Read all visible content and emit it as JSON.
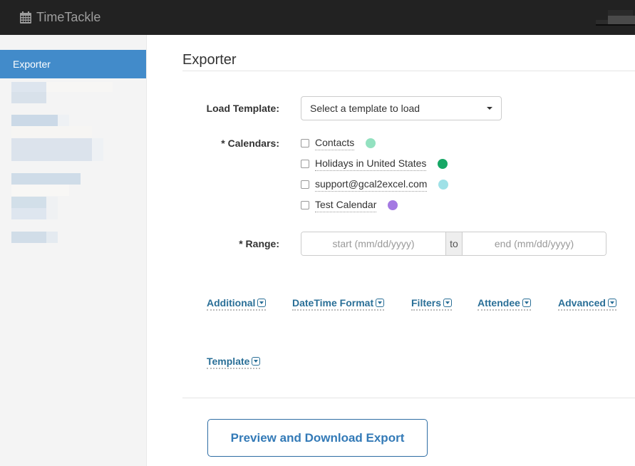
{
  "app": {
    "name": "TimeTackle",
    "logo_icon": "calendar-icon"
  },
  "sidebar": {
    "active_item": "Exporter",
    "redacted_items_count": 6
  },
  "page": {
    "title": "Exporter"
  },
  "form": {
    "load_template": {
      "label": "Load Template:",
      "placeholder": "Select a template to load"
    },
    "calendars": {
      "label": "* Calendars:",
      "items": [
        {
          "name": "Contacts",
          "checked": false,
          "color": "#93e1c0"
        },
        {
          "name": "Holidays in United States",
          "checked": false,
          "color": "#16a765"
        },
        {
          "name": "support@gcal2excel.com",
          "checked": false,
          "color": "#9fe1e7"
        },
        {
          "name": "Test Calendar",
          "checked": false,
          "color": "#a479e2"
        }
      ]
    },
    "range": {
      "label": "* Range:",
      "start_placeholder": "start (mm/dd/yyyy)",
      "separator": "to",
      "end_placeholder": "end (mm/dd/yyyy)"
    },
    "sections": [
      "Additional",
      "DateTime Format",
      "Filters",
      "Attendee",
      "Advanced",
      "Template"
    ],
    "export_button": "Preview and Download Export"
  },
  "colors": {
    "topbar": "#222222",
    "accent": "#428bca",
    "link": "#2a6f97"
  }
}
